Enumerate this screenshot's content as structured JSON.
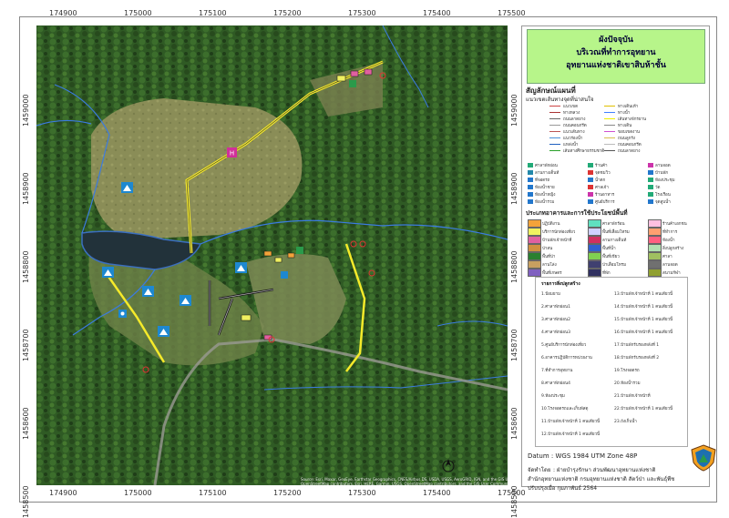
{
  "map": {
    "x_ticks": [
      "174900",
      "175000",
      "175100",
      "175200",
      "175300",
      "175400",
      "175500"
    ],
    "y_ticks": [
      "1459000",
      "1458900",
      "1458800",
      "1458700",
      "1458600",
      "1458500"
    ],
    "attribution": "Source: Esri, Maxar, GeoEye, Earthstar Geographics, CNES/Airbus DS, USDA, USGS, AeroGRID, IGN, and the GIS User Community; OpenStreetMap contributors, Esri, HERE, Garmin, USGS, OpenStreetMap contributors, and the GIS User Community"
  },
  "title": {
    "line1": "ผังปัจจุบัน",
    "line2": "บริเวณที่ทำการอุทยาน",
    "line3": "อุทยานแห่งชาติเขาสิบห้าชั้น"
  },
  "legend": {
    "heading": "สัญลักษณ์แผนที่",
    "subheading": "แนวเขตเส้นทางจุดที่น่าสนใจ",
    "lines": [
      {
        "label": "แนวเขต",
        "color": "#c44"
      },
      {
        "label": "ทางหลวง",
        "color": "#a33"
      },
      {
        "label": "ถนนลาดยาง",
        "color": "#666"
      },
      {
        "label": "ถนนคอนกรีต",
        "color": "#999"
      },
      {
        "label": "แนวเส้นทาง",
        "color": "#b55"
      },
      {
        "label": "แนวร่องน้ำ",
        "color": "#4a90d9"
      },
      {
        "label": "แหล่งน้ำ",
        "color": "#2060c0"
      },
      {
        "label": "เส้นทางศึกษาธรรมชาติ",
        "color": "#2aa02a"
      },
      {
        "label": "ทางเดินเท้า",
        "color": "#e0c000"
      },
      {
        "label": "ทางน้ำ",
        "color": "#4080ff"
      },
      {
        "label": "เส้นทางจักรยาน",
        "color": "#f0f000"
      },
      {
        "label": "ทางเดิน",
        "color": "#888"
      },
      {
        "label": "ขอบเขตงาน",
        "color": "#d050d0"
      },
      {
        "label": "ถนนลูกรัง",
        "color": "#d8c050"
      },
      {
        "label": "ถนนคอนกรีต",
        "color": "#bbb"
      },
      {
        "label": "ถนนลาดยาง",
        "color": "#555"
      }
    ],
    "points": [
      {
        "label": "ศาลาพักผ่อน",
        "icon": "pavilion-icon",
        "color": "#2a7"
      },
      {
        "label": "ลานกางเต็นท์",
        "icon": "tent-icon",
        "color": "#28a"
      },
      {
        "label": "ที่จอดรถ",
        "icon": "parking-icon",
        "color": "#27c"
      },
      {
        "label": "ห้องน้ำชาย",
        "icon": "toilet-icon",
        "color": "#27c"
      },
      {
        "label": "ห้องน้ำหญิง",
        "icon": "toilet-icon",
        "color": "#27c"
      },
      {
        "label": "ห้องน้ำรวม",
        "icon": "toilet-icon",
        "color": "#27c"
      },
      {
        "label": "ร้านค้า",
        "icon": "shop-icon",
        "color": "#2a7"
      },
      {
        "label": "จุดชมวิว",
        "icon": "viewpoint-icon",
        "color": "#d33"
      },
      {
        "label": "น้ำตก",
        "icon": "waterfall-icon",
        "color": "#27c"
      },
      {
        "label": "ศาลเจ้า",
        "icon": "shrine-icon",
        "color": "#d33"
      },
      {
        "label": "ร้านอาหาร",
        "icon": "restaurant-icon",
        "color": "#c3a"
      },
      {
        "label": "ศูนย์บริการ",
        "icon": "info-icon",
        "color": "#27c"
      },
      {
        "label": "ลานจอด",
        "icon": "helipad-icon",
        "color": "#c3a"
      },
      {
        "label": "บ้านพัก",
        "icon": "house-icon",
        "color": "#27c"
      },
      {
        "label": "ห้องประชุม",
        "icon": "meeting-icon",
        "color": "#2a7"
      },
      {
        "label": "วัด",
        "icon": "temple-icon",
        "color": "#2a7"
      },
      {
        "label": "โรงเรือน",
        "icon": "building-icon",
        "color": "#2a7"
      },
      {
        "label": "จุดสูบน้ำ",
        "icon": "pump-icon",
        "color": "#27c"
      }
    ],
    "landuse_heading": "ประเภทอาคารและการใช้ประโยชน์พื้นที่",
    "landuse": [
      {
        "label": "ปฏิบัติงาน",
        "color": "#f3a33a"
      },
      {
        "label": "บริการนักท่องเที่ยว",
        "color": "#f0f060"
      },
      {
        "label": "บ้านพักเจ้าหน้าที่",
        "color": "#e060a0"
      },
      {
        "label": "ป่าสน",
        "color": "#d09040"
      },
      {
        "label": "พื้นที่ป่า",
        "color": "#2a8030"
      },
      {
        "label": "ลานโล่ง",
        "color": "#c8a060"
      },
      {
        "label": "พื้นที่เกษตร",
        "color": "#8060c0"
      },
      {
        "label": "ศาลาพักร้อน",
        "color": "#60e0c0"
      },
      {
        "label": "พื้นที่เสื่อมโทรม",
        "color": "#d0d0ff"
      },
      {
        "label": "ลานกางเต็นท์",
        "color": "#d03060"
      },
      {
        "label": "พื้นที่น้ำ",
        "color": "#3060d0"
      },
      {
        "label": "พื้นที่เขียว",
        "color": "#80d050"
      },
      {
        "label": "ป่าเสื่อมโทรม",
        "color": "#404070"
      },
      {
        "label": "ที่พัก",
        "color": "#303060"
      },
      {
        "label": "ร้านค้าเอกชน",
        "color": "#ffc0e0"
      },
      {
        "label": "ที่ทำการ",
        "color": "#ffa070"
      },
      {
        "label": "ห้องน้ำ",
        "color": "#ff6080"
      },
      {
        "label": "สิ่งปลูกสร้าง",
        "color": "#b0e0b0"
      },
      {
        "label": "ศาลา",
        "color": "#a0c060"
      },
      {
        "label": "ลานจอด",
        "color": "#707070"
      },
      {
        "label": "สนามกีฬา",
        "color": "#90a030"
      }
    ]
  },
  "building_list": {
    "heading": "รายการสิ่งปลูกสร้าง",
    "col1": [
      "1.ป้อมยาม",
      "2.ศาลาพักผ่อน1",
      "3.ศาลาพักผ่อน2",
      "4.ศาลาพักผ่อน3",
      "5.ศูนย์บริการนักท่องเที่ยว",
      "6.อาคารปฏิบัติการหน่วยงาน",
      "7.ที่ทำการอุทยาน",
      "8.ศาลาพักผ่อน4",
      "9.ห้องประชุม",
      "10.โรงจอดรถและเก็บพัสดุ",
      "11.บ้านพักเจ้าหน้าที่ 1 คนเดียวนี้",
      "12.บ้านพักเจ้าหน้าที่ 1 คนเดียวนี้"
    ],
    "col2": [
      "13.บ้านพักเจ้าหน้าที่ 1 คนเดียวนี้",
      "14.บ้านพักเจ้าหน้าที่ 1 คนเดียวนี้",
      "15.บ้านพักเจ้าหน้าที่ 1 คนเดียวนี้",
      "16.บ้านพักเจ้าหน้าที่ 1 คนเดียวนี้",
      "17.บ้านพักรับรองหลังที่ 1",
      "18.บ้านพักรับรองหลังที่ 2",
      "19.โรงจอดรถ",
      "20.ห้องน้ำรวม",
      "21.บ้านพักเจ้าหน้าที่",
      "22.บ้านพักเจ้าหน้าที่ 1 คนเดียวนี้",
      "23.ถังเก็บน้ำ"
    ]
  },
  "footer": {
    "datum": "Datum : WGS 1984 UTM Zone 48P",
    "producer_label": "จัดทำโดย",
    "producer": ": ฝ่ายบำรุงรักษา ส่วนพัฒนาอุทยานแห่งชาติ",
    "office": "สำนักอุทยานแห่งชาติ กรมอุทยานแห่งชาติ สัตว์ป่า และพันธุ์พืช",
    "updated": "ปรับปรุงเมื่อ กุมภาพันธ์ 2564"
  }
}
